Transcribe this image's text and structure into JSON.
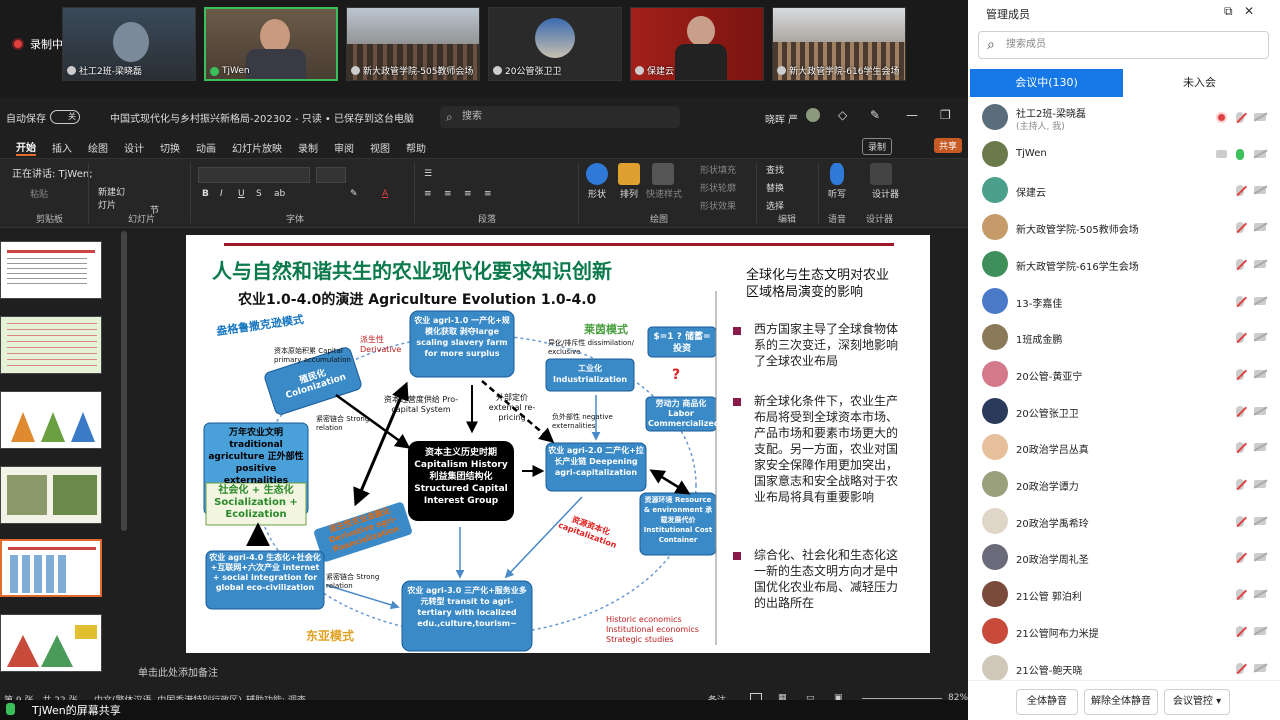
{
  "recording": {
    "label": "录制中"
  },
  "video_tiles": [
    {
      "name": "社工2班-梁晓磊"
    },
    {
      "name": "TjWen"
    },
    {
      "name": "新大政管学院-505教师会场"
    },
    {
      "name": "20公管张卫卫"
    },
    {
      "name": "保建云"
    },
    {
      "name": "新大政管学院-616学生会场"
    }
  ],
  "ppt": {
    "autosave_label": "自动保存",
    "autosave_state": "关",
    "doc_title": "中国式现代化与乡村振兴新格局-202302 - 只读 • 已保存到这台电脑",
    "search_placeholder": "搜索",
    "user": "晓晖 严",
    "menu": [
      "开始",
      "插入",
      "绘图",
      "设计",
      "切换",
      "动画",
      "幻灯片放映",
      "录制",
      "审阅",
      "视图",
      "帮助"
    ],
    "record_button": "录制",
    "share_button": "共享",
    "speaking": "正在讲话: TjWen;",
    "ribbon": {
      "paste": "粘贴",
      "new_slide": "新建幻灯片",
      "sections": "节",
      "clipboard_group": "剪贴板",
      "slides_group": "幻灯片",
      "font_group": "字体",
      "paragraph_group": "段落",
      "shape": "形状",
      "arrange": "排列",
      "quick_styles": "快速样式",
      "fill": "形状填充",
      "outline": "形状轮廓",
      "effect": "形状效果",
      "drawing_group": "绘图",
      "find": "查找",
      "replace": "替换",
      "select": "选择",
      "editing_group": "编辑",
      "dictate": "听写",
      "voice_group": "语音",
      "designer": "设计器",
      "designer_group": "设计器"
    },
    "notes_placeholder": "单击此处添加备注",
    "status": {
      "slide_counter": "第 9 张，共 22 张",
      "language": "中文(繁体汉语, 中国香港特别行政区)",
      "accessibility": "辅助功能: 调查",
      "notes": "备注",
      "zoom": "82%"
    },
    "screen_share": "TjWen的屏幕共享"
  },
  "slide": {
    "title": "人与自然和谐共生的农业现代化要求知识创新",
    "subtitle": "农业1.0-4.0的演进 Agriculture Evolution 1.0-4.0",
    "left_labels": {
      "plantation_mode": "盎格鲁撒克逊模式",
      "family_mode": "莱茵模式",
      "east_asia_mode": "东亚模式",
      "capital_accum": "资本原始积累 Capital primary accumulation",
      "derivative": "派生性 Derivative",
      "colonization": "殖民化 Colonization",
      "agri1": "农业 agri-1.0 一产化+规模化获取 剥夺large scaling slavery farm for more surplus",
      "capital_history": "资本主义历史时期Capitalism History 利益集团结构化 Structured Capital Interest Group",
      "capital_supply": "资本经营度供给 Pro-capital System",
      "strong_relation": "紧密链合 Strong relation",
      "traditional": "万年农业文明 traditional agriculture 正外部性 positive externalities",
      "social_eco": "社会化 + 生态化 Socialization + Ecolization",
      "derivative_agri": "派生性农业金融化 Derivative agri-financialization",
      "agri4": "农业 agri-4.0 生态化+社会化+互联网+六次产业 internet + social integration for global eco-civilization",
      "strong_relation_2": "紧密链合 Strong relation",
      "agri3": "农业 agri-3.0 三产化+服务业多元转型 transit to agri-tertiary with localized edu.,culture,tourism~",
      "dissimilation": "异化/排斥性 dissimilation/ exclusive",
      "industrialization": "工业化 Industrialization",
      "dollar": "$=1 ? 储蓄=投资",
      "question": "?",
      "external_pricing": "外部定价 external re-pricing",
      "negative_ext": "负外部性 negative externalities",
      "labor": "劳动力 商品化 Labor Commercialized",
      "agri2": "农业 agri-2.0 二产化+拉长产业链 Deepening agri-capitalization",
      "resource_env": "资源环境 Resource & environment 承载发展代价 Institutional Cost Container",
      "capitalization": "资源资本化 capitalization",
      "economics": [
        "Historic economics",
        "Institutional economics",
        "Strategic studies"
      ]
    },
    "right_heading": "全球化与生态文明对农业区域格局演变的影响",
    "bullets": [
      "西方国家主导了全球食物体系的三次变迁，深刻地影响了全球农业布局",
      "新全球化条件下，农业生产布局将受到全球资本市场、产品市场和要素市场更大的支配。另一方面，农业对国家安全保障作用更加突出，国家意志和安全战略对于农业布局将具有重要影响",
      "综合化、社会化和生态化这一新的生态文明方向才是中国优化农业布局、减轻压力的出路所在"
    ]
  },
  "panel": {
    "title": "管理成员",
    "search_placeholder": "搜索成员",
    "tab_in_meeting": "会议中(130)",
    "tab_not_joined": "未入会",
    "members": [
      {
        "name": "社工2班-梁晓磊",
        "sub": "(主持人, 我)",
        "avatar_color": "#5a6d7a"
      },
      {
        "name": "TjWen",
        "sub": "",
        "avatar_color": "#6b7a4a"
      },
      {
        "name": "保建云",
        "sub": "",
        "avatar_color": "#4aa08a"
      },
      {
        "name": "新大政管学院-505教师会场",
        "sub": "",
        "avatar_color": "#c79a6a"
      },
      {
        "name": "新大政管学院-616学生会场",
        "sub": "",
        "avatar_color": "#3f8f5a"
      },
      {
        "name": "13-李嘉佳",
        "sub": "",
        "avatar_color": "#4a7ac7"
      },
      {
        "name": "1班成金鹏",
        "sub": "",
        "avatar_color": "#8a7a5a"
      },
      {
        "name": "20公管-黄亚宁",
        "sub": "",
        "avatar_color": "#d47a8a"
      },
      {
        "name": "20公管张卫卫",
        "sub": "",
        "avatar_color": "#2a3a5a"
      },
      {
        "name": "20政治学吕丛真",
        "sub": "",
        "avatar_color": "#e6c09a"
      },
      {
        "name": "20政治学谭力",
        "sub": "",
        "avatar_color": "#9aa07a"
      },
      {
        "name": "20政治学禹希玲",
        "sub": "",
        "avatar_color": "#e0d6c8"
      },
      {
        "name": "20政治学周礼圣",
        "sub": "",
        "avatar_color": "#6a6a7a"
      },
      {
        "name": "21公管 郭泊利",
        "sub": "",
        "avatar_color": "#7a4a3a"
      },
      {
        "name": "21公管阿布力米提",
        "sub": "",
        "avatar_color": "#c74a3a"
      },
      {
        "name": "21公管-鲍天晓",
        "sub": "",
        "avatar_color": "#d0c8b8"
      }
    ],
    "mute_all": "全体静音",
    "unmute_all": "解除全体静音",
    "controls": "会议管控"
  }
}
